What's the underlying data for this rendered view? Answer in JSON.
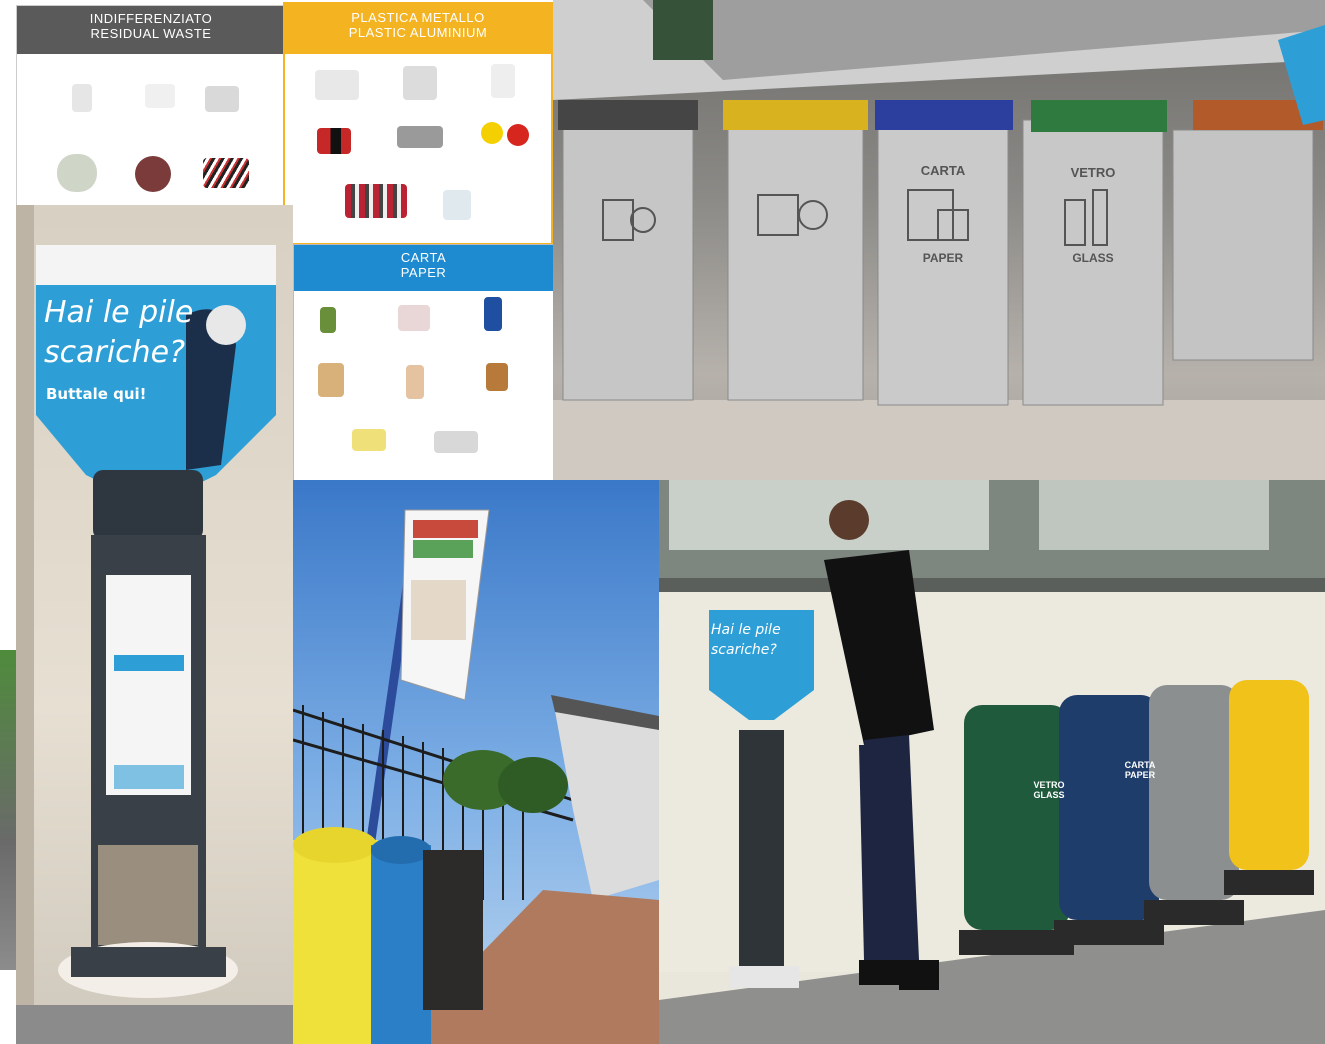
{
  "signs": {
    "residual": {
      "line1": "INDIFFERENZIATO",
      "line2": "RESIDUAL WASTE"
    },
    "plastic": {
      "line1": "PLASTICA METALLO",
      "line2": "PLASTIC ALUMINIUM"
    },
    "paper": {
      "line1": "CARTA",
      "line2": "PAPER"
    }
  },
  "battery_poster": {
    "line1": "Hai le pile",
    "line2": "scariche?",
    "line3": "Buttale qui!"
  },
  "station_bins": [
    {
      "it": "CARTA",
      "en": "PAPER",
      "lid_color": "#2c3e9e"
    },
    {
      "it": "VETRO",
      "en": "GLASS",
      "lid_color": "#2f7a3f"
    }
  ],
  "street_bins": [
    {
      "label": "VETRO GLASS",
      "color": "#1f5a3c"
    },
    {
      "label": "CARTA PAPER",
      "color": "#1f3d6b"
    },
    {
      "label": "",
      "color": "#8c8f90"
    },
    {
      "label": "",
      "color": "#f0c21a"
    }
  ],
  "colors": {
    "residual": "#5a5a5a",
    "plastic": "#f4b321",
    "paper": "#1e8bd0",
    "poster_blue": "#2d9fd6"
  }
}
